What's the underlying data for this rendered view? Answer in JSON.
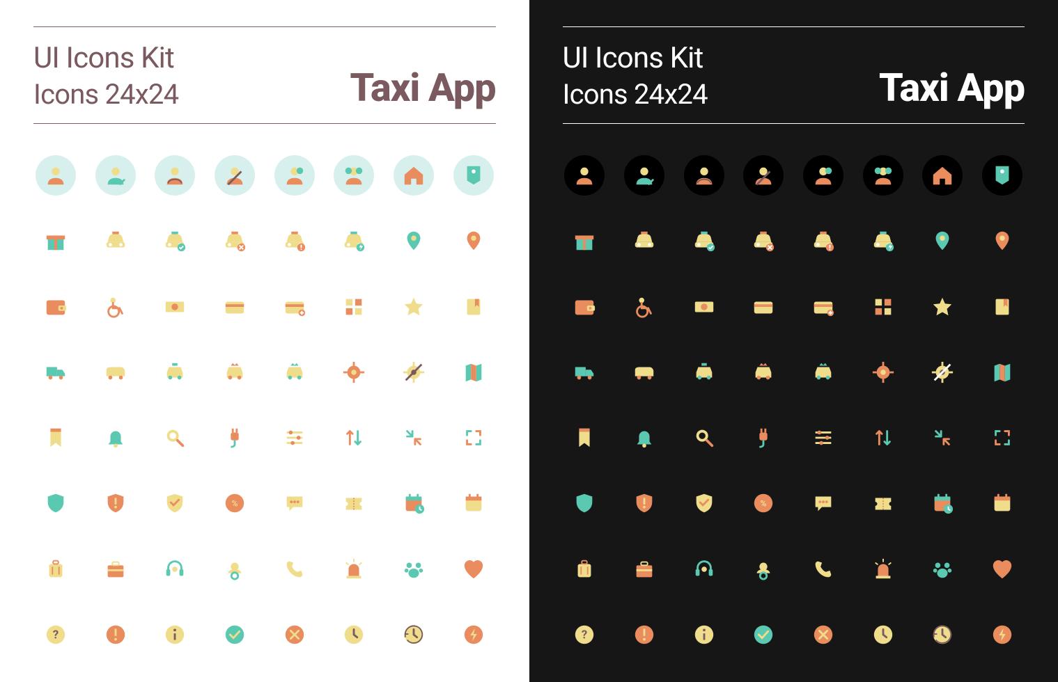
{
  "header": {
    "title_line1": "UI Icons Kit",
    "title_line2": "Icons 24x24",
    "app_name": "Taxi App"
  },
  "palette": {
    "mint": "#5bc9b1",
    "cream": "#f0dd8c",
    "orange": "#e98c5e",
    "plum": "#7a5a5f",
    "white": "#ffffff",
    "black": "#161616"
  },
  "icons": [
    [
      {
        "name": "user-icon",
        "bg": true,
        "c1": "orange",
        "c2": "cream"
      },
      {
        "name": "user-check-icon",
        "bg": true,
        "c1": "mint",
        "c2": "cream"
      },
      {
        "name": "user-driver-icon",
        "bg": true,
        "c1": "orange",
        "c2": "cream"
      },
      {
        "name": "user-seatbelt-icon",
        "bg": true,
        "c1": "orange",
        "c2": "cream"
      },
      {
        "name": "users-pair-icon",
        "bg": true,
        "c1": "orange",
        "c2": "cream"
      },
      {
        "name": "users-group-icon",
        "bg": true,
        "c1": "orange",
        "c2": "cream"
      },
      {
        "name": "home-icon",
        "bg": true,
        "c1": "orange",
        "c2": "cream"
      },
      {
        "name": "tag-home-icon",
        "bg": true,
        "c1": "mint",
        "c2": "cream"
      }
    ],
    [
      {
        "name": "gift-icon",
        "c1": "mint",
        "c2": "orange"
      },
      {
        "name": "taxi-front-icon",
        "c1": "cream",
        "c2": "orange"
      },
      {
        "name": "taxi-check-icon",
        "c1": "cream",
        "c2": "mint"
      },
      {
        "name": "taxi-cancel-icon",
        "c1": "cream",
        "c2": "orange"
      },
      {
        "name": "taxi-alert-icon",
        "c1": "cream",
        "c2": "orange"
      },
      {
        "name": "taxi-electric-icon",
        "c1": "cream",
        "c2": "mint"
      },
      {
        "name": "pin-icon",
        "c1": "mint",
        "c2": "cream"
      },
      {
        "name": "pin-filled-icon",
        "c1": "orange",
        "c2": "cream"
      }
    ],
    [
      {
        "name": "wallet-icon",
        "c1": "orange",
        "c2": "cream"
      },
      {
        "name": "wheelchair-icon",
        "c1": "cream",
        "c2": "orange"
      },
      {
        "name": "cash-icon",
        "c1": "cream",
        "c2": "orange"
      },
      {
        "name": "card-icon",
        "c1": "cream",
        "c2": "orange"
      },
      {
        "name": "card-add-icon",
        "c1": "cream",
        "c2": "orange"
      },
      {
        "name": "blocks-icon",
        "c1": "cream",
        "c2": "orange"
      },
      {
        "name": "star-icon",
        "c1": "cream",
        "c2": "cream"
      },
      {
        "name": "bookmark-icon",
        "c1": "cream",
        "c2": "orange"
      }
    ],
    [
      {
        "name": "truck-icon",
        "c1": "mint",
        "c2": "orange"
      },
      {
        "name": "van-icon",
        "c1": "cream",
        "c2": "orange"
      },
      {
        "name": "car-taxi-icon",
        "c1": "cream",
        "c2": "mint"
      },
      {
        "name": "car-crown-icon",
        "c1": "cream",
        "c2": "orange"
      },
      {
        "name": "car-vip-icon",
        "c1": "cream",
        "c2": "mint"
      },
      {
        "name": "crosshair-icon",
        "c1": "orange",
        "c2": "cream"
      },
      {
        "name": "crosshair-off-icon",
        "c1": "cream",
        "c2": "plum"
      },
      {
        "name": "map-icon",
        "c1": "mint",
        "c2": "orange"
      }
    ],
    [
      {
        "name": "bookmark-ribbon-icon",
        "c1": "cream",
        "c2": "orange"
      },
      {
        "name": "bell-icon",
        "c1": "mint",
        "c2": "cream"
      },
      {
        "name": "search-icon",
        "c1": "cream",
        "c2": "orange"
      },
      {
        "name": "plug-icon",
        "c1": "orange",
        "c2": "mint"
      },
      {
        "name": "sliders-icon",
        "c1": "orange",
        "c2": "cream"
      },
      {
        "name": "sort-icon",
        "c1": "orange",
        "c2": "mint"
      },
      {
        "name": "collapse-icon",
        "c1": "mint",
        "c2": "orange"
      },
      {
        "name": "expand-icon",
        "c1": "mint",
        "c2": "orange"
      }
    ],
    [
      {
        "name": "shield-icon",
        "c1": "mint",
        "c2": "cream"
      },
      {
        "name": "shield-alert-icon",
        "c1": "orange",
        "c2": "cream"
      },
      {
        "name": "shield-check-icon",
        "c1": "cream",
        "c2": "orange"
      },
      {
        "name": "discount-icon",
        "c1": "orange",
        "c2": "cream"
      },
      {
        "name": "chat-icon",
        "c1": "cream",
        "c2": "orange"
      },
      {
        "name": "ticket-icon",
        "c1": "cream",
        "c2": "orange"
      },
      {
        "name": "calendar-clock-icon",
        "c1": "orange",
        "c2": "mint"
      },
      {
        "name": "calendar-icon",
        "c1": "cream",
        "c2": "orange"
      }
    ],
    [
      {
        "name": "luggage-icon",
        "c1": "cream",
        "c2": "orange"
      },
      {
        "name": "briefcase-icon",
        "c1": "orange",
        "c2": "cream"
      },
      {
        "name": "headset-icon",
        "c1": "mint",
        "c2": "cream"
      },
      {
        "name": "pacifier-icon",
        "c1": "cream",
        "c2": "mint"
      },
      {
        "name": "phone-icon",
        "c1": "cream",
        "c2": "cream"
      },
      {
        "name": "siren-icon",
        "c1": "orange",
        "c2": "cream"
      },
      {
        "name": "paw-icon",
        "c1": "mint",
        "c2": "cream"
      },
      {
        "name": "heart-icon",
        "c1": "orange",
        "c2": "orange"
      }
    ],
    [
      {
        "name": "help-icon",
        "shape": "circle",
        "c1": "cream",
        "c2": "plum"
      },
      {
        "name": "warning-icon",
        "shape": "circle",
        "c1": "orange",
        "c2": "cream"
      },
      {
        "name": "info-icon",
        "shape": "circle",
        "c1": "cream",
        "c2": "plum"
      },
      {
        "name": "success-icon",
        "shape": "circle",
        "c1": "mint",
        "c2": "cream"
      },
      {
        "name": "error-icon",
        "shape": "circle",
        "c1": "orange",
        "c2": "cream"
      },
      {
        "name": "clock-icon",
        "shape": "circle",
        "c1": "cream",
        "c2": "plum"
      },
      {
        "name": "history-icon",
        "shape": "circle",
        "c1": "cream",
        "c2": "plum"
      },
      {
        "name": "flash-icon",
        "shape": "circle",
        "c1": "orange",
        "c2": "cream"
      }
    ]
  ]
}
